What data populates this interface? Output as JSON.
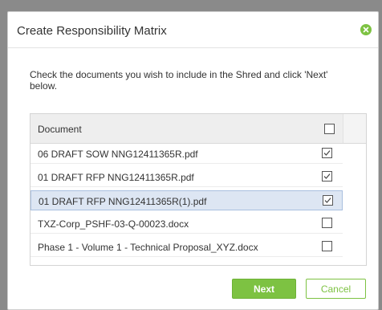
{
  "dialog": {
    "title": "Create Responsibility Matrix",
    "instructions": "Check the documents you wish to include in the Shred and click 'Next' below.",
    "column_header": "Document",
    "documents": [
      {
        "name": "06 DRAFT SOW NNG12411365R.pdf",
        "checked": true,
        "selected": false
      },
      {
        "name": "01 DRAFT RFP NNG12411365R.pdf",
        "checked": true,
        "selected": false
      },
      {
        "name": "01 DRAFT RFP NNG12411365R(1).pdf",
        "checked": true,
        "selected": true
      },
      {
        "name": "TXZ-Corp_PSHF-03-Q-00023.docx",
        "checked": false,
        "selected": false
      },
      {
        "name": "Phase 1 - Volume 1 - Technical Proposal_XYZ.docx",
        "checked": false,
        "selected": false
      }
    ],
    "select_all_checked": false,
    "next_label": "Next",
    "cancel_label": "Cancel"
  },
  "colors": {
    "accent": "#7dc242",
    "selected_row": "#dde6f3"
  },
  "icons": {
    "close": "close-circle-icon",
    "check": "checkmark-icon"
  }
}
